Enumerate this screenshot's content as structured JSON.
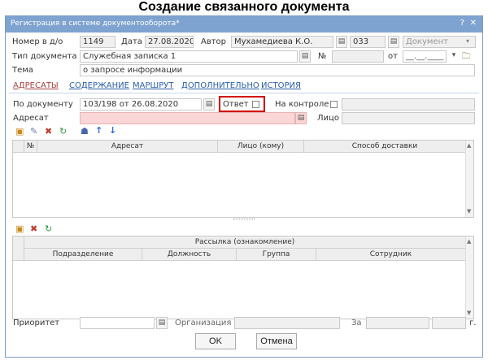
{
  "heading": "Создание связанного документа",
  "window": {
    "title": "Регистрация в системе документооборота*",
    "help": "?",
    "close": "✕"
  },
  "row1": {
    "nomer_label": "Номер в д/о",
    "nomer_value": "1149",
    "data_label": "Дата",
    "data_value": "27.08.2020",
    "avtor_label": "Автор",
    "avtor_value": "Мухамедиева К.О.",
    "num_value": "033",
    "doc_value": "Документ"
  },
  "row2": {
    "tip_label": "Тип документа",
    "tip_value": "Служебная записка 1",
    "no_label": "№",
    "ot_label": "от",
    "date_placeholder": "__.__.____"
  },
  "row3": {
    "tema_label": "Тема",
    "tema_value": "о запросе информации"
  },
  "tabs": [
    "АДРЕСАТЫ",
    "СОДЕРЖАНИЕ",
    "МАРШРУТ",
    "ДОПОЛНИТЕЛЬНО",
    "ИСТОРИЯ"
  ],
  "row4": {
    "po_doc_label": "По документу",
    "po_doc_value": "103/198 от 26.08.2020",
    "otvet_label": "Ответ",
    "kontrol_label": "На контроле"
  },
  "row5": {
    "adresat_label": "Адресат",
    "lico_label": "Лицо"
  },
  "grid1": {
    "headers": [
      "№",
      "Адресат",
      "Лицо (кому)",
      "Способ доставки"
    ]
  },
  "grid2": {
    "group_header": "Рассылка (ознакомление)",
    "headers": [
      "Подразделение",
      "Должность",
      "Группа",
      "Сотрудник"
    ]
  },
  "bottom": {
    "priority_label": "Приоритет",
    "org_label": "Организация",
    "za_label": "За",
    "g_label": "г."
  },
  "buttons": {
    "ok": "OK",
    "cancel": "Отмена"
  },
  "colors": {
    "titlebar": "#7fa3d0",
    "tab_link": "#2a5ea8",
    "required": "#fbd6d6",
    "highlight": "#d00000"
  }
}
